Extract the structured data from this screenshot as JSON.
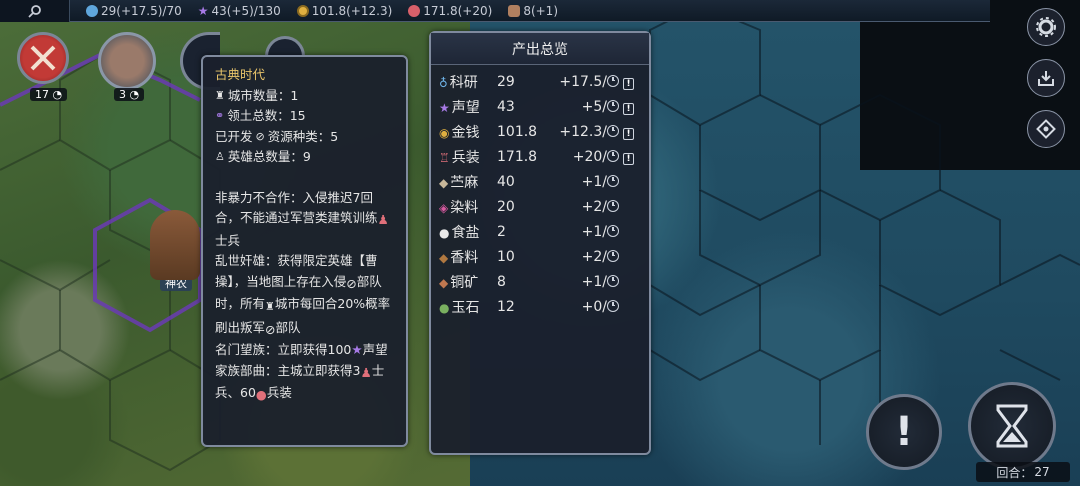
{
  "topbar": {
    "science": "29(+17.5)/70",
    "prestige": "43(+5)/130",
    "gold": "101.8(+12.3)",
    "armament": "171.8(+20)",
    "hemp": "8(+1)"
  },
  "avatars": [
    {
      "label": "17"
    },
    {
      "label": "3"
    }
  ],
  "map_label": "神农",
  "era_panel": {
    "title": "古典时代",
    "cities": "城市数量：1",
    "territory": "领土总数：15",
    "resources": "已开发",
    "resources_tail": "资源种类：5",
    "heroes": "英雄总数量：9",
    "desc1": "非暴力不合作：入侵推迟7回合，不能通过军营类建筑训练",
    "desc1_tail": "士兵",
    "desc2a": "乱世奸雄：获得限定英雄【曹操】，当地图上存在入侵",
    "desc2b": "部队时，所有",
    "desc2c": "城市每回合20%概率刷出叛军",
    "desc2d": "部队",
    "desc3a": "名门望族：立即获得100",
    "desc3b": "声望",
    "desc4a": "家族部曲：主城立即获得3",
    "desc4b": "士兵、60",
    "desc4c": "兵装"
  },
  "production": {
    "title": "产出总览",
    "rows": [
      {
        "name": "科研",
        "value": "29",
        "delta": "+17.5/",
        "icon": "flask-icon",
        "color": "#6fb4e8",
        "alert": true
      },
      {
        "name": "声望",
        "value": "43",
        "delta": "+5/",
        "icon": "star-icon",
        "color": "#a77ae6",
        "alert": true
      },
      {
        "name": "金钱",
        "value": "101.8",
        "delta": "+12.3/",
        "icon": "coin-icon",
        "color": "#e0b040",
        "alert": true
      },
      {
        "name": "兵装",
        "value": "171.8",
        "delta": "+20/",
        "icon": "armor-icon",
        "color": "#e0707a",
        "alert": true
      },
      {
        "name": "苎麻",
        "value": "40",
        "delta": "+1/",
        "icon": "hemp-icon",
        "color": "#c8b89a",
        "alert": false
      },
      {
        "name": "染料",
        "value": "20",
        "delta": "+2/",
        "icon": "dye-icon",
        "color": "#d85aa0",
        "alert": false
      },
      {
        "name": "食盐",
        "value": "2",
        "delta": "+1/",
        "icon": "salt-icon",
        "color": "#e8e8e8",
        "alert": false
      },
      {
        "name": "香料",
        "value": "10",
        "delta": "+2/",
        "icon": "spice-icon",
        "color": "#b07840",
        "alert": false
      },
      {
        "name": "铜矿",
        "value": "8",
        "delta": "+1/",
        "icon": "copper-icon",
        "color": "#c07850",
        "alert": false
      },
      {
        "name": "玉石",
        "value": "12",
        "delta": "+0/",
        "icon": "jade-icon",
        "color": "#7ab060",
        "alert": false
      }
    ]
  },
  "turn": {
    "label": "回合：",
    "value": "27"
  },
  "colors": {
    "accent_gold": "#e8c46a",
    "panel_border": "#7f8a9e"
  }
}
